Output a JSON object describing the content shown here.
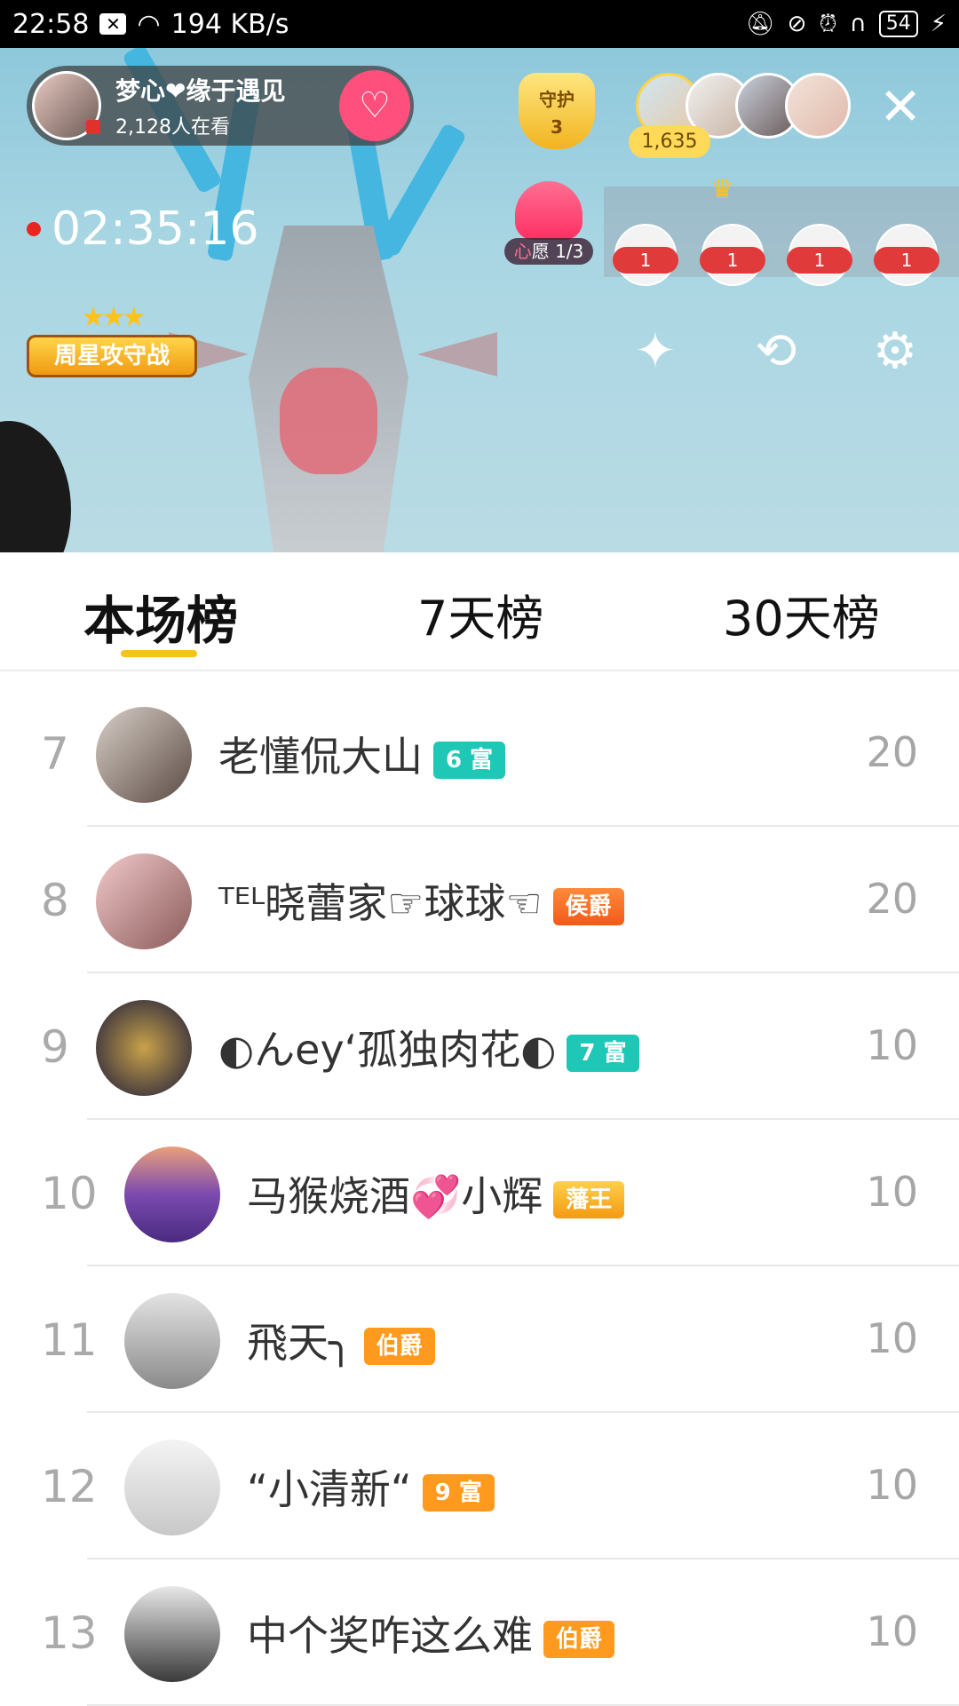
{
  "status_bar": {
    "time": "22:58",
    "speed": "194 KB/s",
    "battery": "54"
  },
  "stream": {
    "host_name": "梦心❤缘于遇见",
    "viewers": "2,128人在看",
    "guard_label": "守护",
    "guard_count": "3",
    "audience_count": "1,635",
    "timer": "02:35:16",
    "wish_label_prefix": "心",
    "wish_label_suffix": "愿 1/3",
    "fans": [
      "1",
      "1",
      "1",
      "1"
    ],
    "weekstar_label": "周星攻守战"
  },
  "tabs": [
    "本场榜",
    "7天榜",
    "30天榜"
  ],
  "ranking": [
    {
      "rank": "7",
      "name": "老懂侃大山",
      "badge": "6 富",
      "badge_style": "teal",
      "score": "20"
    },
    {
      "rank": "8",
      "name": "ᵀᴱᴸ晓蕾家☞球球☜",
      "badge": "侯爵",
      "badge_style": "red",
      "score": "20"
    },
    {
      "rank": "9",
      "name": "◐んey‘孤独肉花◐",
      "badge": "7 富",
      "badge_style": "teal",
      "score": "10"
    },
    {
      "rank": "10",
      "name": "马猴烧酒💞小辉",
      "badge": "藩王",
      "badge_style": "gold",
      "score": "10"
    },
    {
      "rank": "11",
      "name": "飛天╮",
      "badge": "伯爵",
      "badge_style": "orange",
      "score": "10"
    },
    {
      "rank": "12",
      "name": "“小清新“",
      "badge": "9 富",
      "badge_style": "orange",
      "score": "10"
    },
    {
      "rank": "13",
      "name": "中个奖咋这么难",
      "badge": "伯爵",
      "badge_style": "orange",
      "score": "10"
    }
  ],
  "colors": {
    "tab_indicator": "#f7c21a",
    "follow_button": "#ff4f7c",
    "badge_teal": "#1fc7b7",
    "badge_orange": "#ff9a1f"
  }
}
